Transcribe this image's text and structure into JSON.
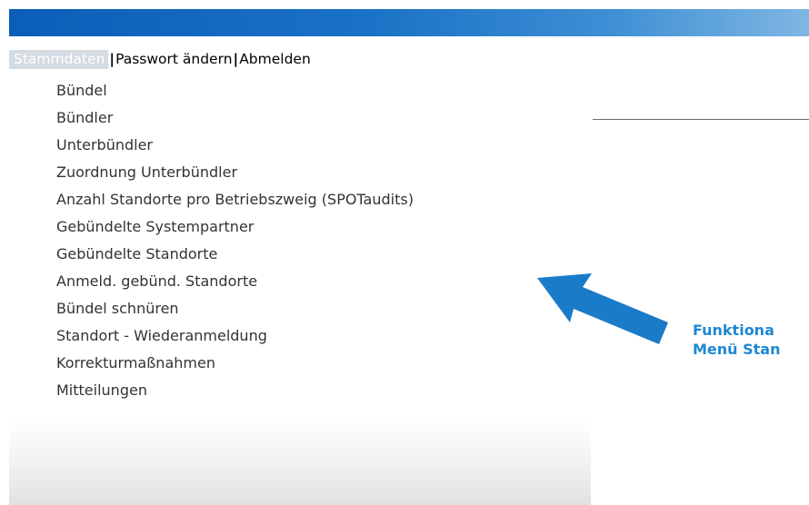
{
  "header": {
    "color": "#0a5eb8"
  },
  "topnav": {
    "items": [
      {
        "label": "Stammdaten"
      },
      {
        "label": "Passwort ändern"
      },
      {
        "label": "Abmelden"
      }
    ],
    "separator": "|",
    "active_bg": "#d3dbe3"
  },
  "menu": {
    "items": [
      {
        "label": "Bündel"
      },
      {
        "label": "Bündler"
      },
      {
        "label": "Unterbündler"
      },
      {
        "label": "Zuordnung Unterbündler"
      },
      {
        "label": "Anzahl Standorte pro Betriebszweig (SPOTaudits)"
      },
      {
        "label": "Gebündelte Systempartner"
      },
      {
        "label": "Gebündelte Standorte"
      },
      {
        "label": "Anmeld. gebünd. Standorte"
      },
      {
        "label": "Bündel schnüren"
      },
      {
        "label": "Standort - Wiederanmeldung"
      },
      {
        "label": "Korrekturmaßnahmen"
      },
      {
        "label": "Mitteilungen"
      }
    ]
  },
  "annotation": {
    "line1": "Funktiona",
    "line2": "Menü Stan",
    "color": "#1e88d2",
    "arrow_color": "#1a7bc9",
    "arrow_icon": "arrow-up-left-icon"
  }
}
